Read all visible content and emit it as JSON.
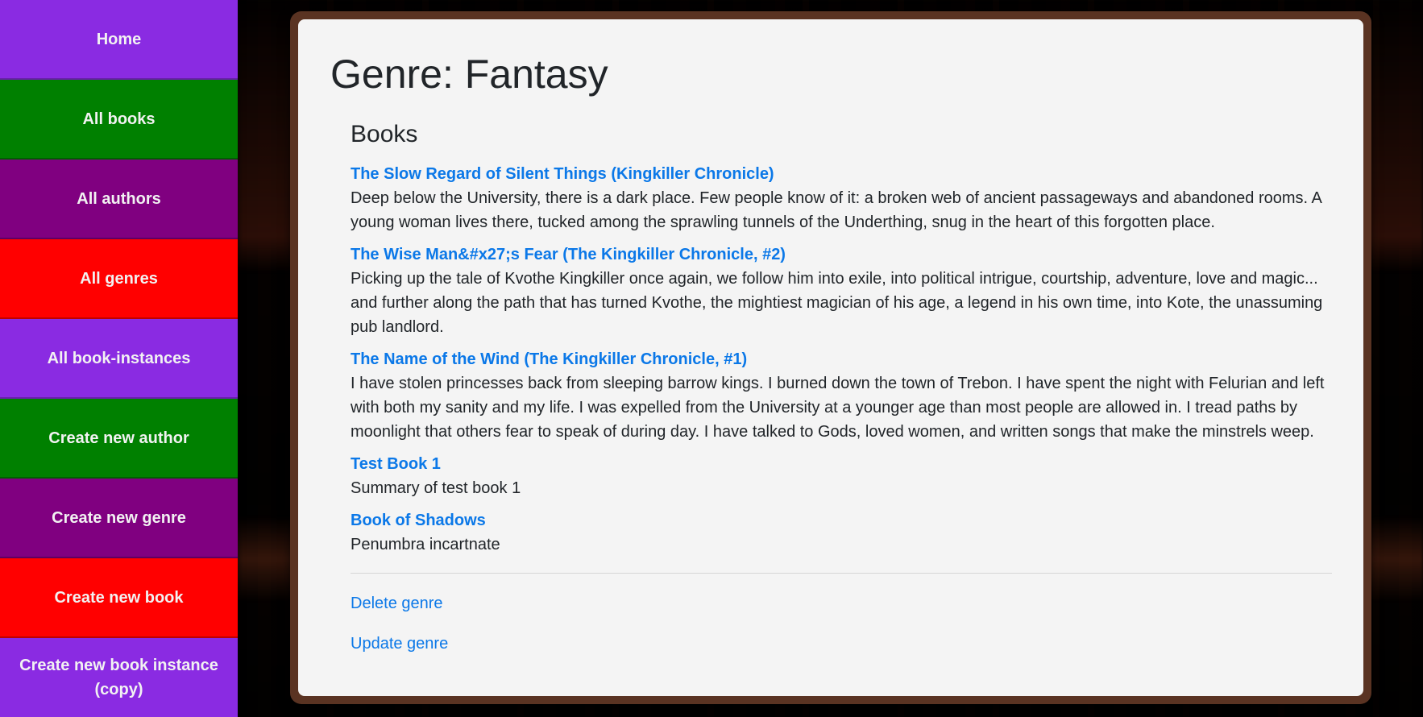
{
  "sidebar": {
    "items": [
      {
        "label": "Home",
        "color": "#8a2be2"
      },
      {
        "label": "All books",
        "color": "#008000"
      },
      {
        "label": "All authors",
        "color": "#800080"
      },
      {
        "label": "All genres",
        "color": "#ff0000"
      },
      {
        "label": "All book-instances",
        "color": "#8a2be2"
      },
      {
        "label": "Create new author",
        "color": "#008000"
      },
      {
        "label": "Create new genre",
        "color": "#800080"
      },
      {
        "label": "Create new book",
        "color": "#ff0000"
      },
      {
        "label": "Create new book instance (copy)",
        "color": "#8a2be2"
      }
    ]
  },
  "main": {
    "title": "Genre: Fantasy",
    "section_title": "Books",
    "books": [
      {
        "title": "The Slow Regard of Silent Things (Kingkiller Chronicle)",
        "summary": "Deep below the University, there is a dark place. Few people know of it: a broken web of ancient passageways and abandoned rooms. A young woman lives there, tucked among the sprawling tunnels of the Underthing, snug in the heart of this forgotten place."
      },
      {
        "title": "The Wise Man&#x27;s Fear (The Kingkiller Chronicle, #2)",
        "summary": "Picking up the tale of Kvothe Kingkiller once again, we follow him into exile, into political intrigue, courtship, adventure, love and magic... and further along the path that has turned Kvothe, the mightiest magician of his age, a legend in his own time, into Kote, the unassuming pub landlord."
      },
      {
        "title": "The Name of the Wind (The Kingkiller Chronicle, #1)",
        "summary": "I have stolen princesses back from sleeping barrow kings. I burned down the town of Trebon. I have spent the night with Felurian and left with both my sanity and my life. I was expelled from the University at a younger age than most people are allowed in. I tread paths by moonlight that others fear to speak of during day. I have talked to Gods, loved women, and written songs that make the minstrels weep."
      },
      {
        "title": "Test Book 1",
        "summary": "Summary of test book 1"
      },
      {
        "title": "Book of Shadows",
        "summary": "Penumbra incartnate"
      }
    ],
    "actions": {
      "delete_label": "Delete genre",
      "update_label": "Update genre"
    }
  },
  "colors": {
    "link": "#0b78e8",
    "card_background": "#f4f4f4",
    "card_frame": "#5a3322"
  }
}
